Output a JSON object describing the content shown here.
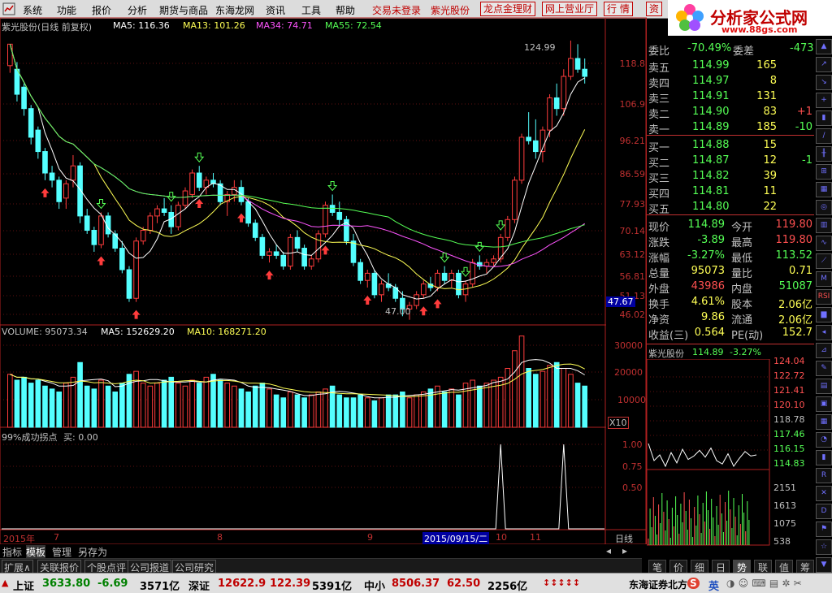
{
  "menubar": {
    "items": [
      "系统",
      "功能",
      "报价",
      "分析",
      "期货与商品",
      "东海龙网",
      "资讯",
      "工具",
      "帮助"
    ],
    "trade_login": "交易未登录",
    "stock_name": "紫光股份",
    "buttons": [
      "龙点金理财",
      "网上营业厅",
      "行 情",
      "资"
    ]
  },
  "logo": {
    "main": "分析家公式网",
    "sub": "www.88gs.com"
  },
  "chart_legend": {
    "title": "紫光股份(日线 前复权)",
    "ma5": "MA5: 116.36",
    "ma13": "MA13: 101.26",
    "ma34": "MA34: 74.71",
    "ma55": "MA55: 72.54"
  },
  "price_scale": [
    "118.8",
    "106.9",
    "96.21",
    "86.59",
    "77.93",
    "70.14",
    "63.12",
    "56.81",
    "51.13",
    "46.02"
  ],
  "annotations": {
    "high": "124.99",
    "low": "47.00",
    "cursor_price": "47.67"
  },
  "volume_legend": {
    "volume": "VOLUME: 95073.34",
    "ma5": "MA5: 152629.20",
    "ma10": "MA10: 168271.20"
  },
  "volume_scale": [
    "30000",
    "20000",
    "10000"
  ],
  "volume_unit": "X10",
  "indicator_legend": {
    "name": "99%成功拐点",
    "buy": "买: 0.00"
  },
  "indicator_scale": [
    "1.00",
    "0.75",
    "0.50"
  ],
  "x_axis": {
    "year": "2015年",
    "months": [
      "7",
      "8",
      "9",
      "10",
      "11"
    ],
    "cursor_date": "2015/09/15/二",
    "period": "日线"
  },
  "bottom_tabs": [
    "指标",
    "模板",
    "管理",
    "另存为"
  ],
  "sub_tabs": [
    "扩展∧",
    "关联报价",
    "个股点评",
    "公司报道",
    "公司研究"
  ],
  "orderbook": {
    "header": {
      "weibi_label": "委比",
      "weibi": "-70.49%",
      "weicha_label": "委差",
      "weicha": "-473"
    },
    "asks": [
      {
        "label": "卖五",
        "price": "114.99",
        "vol": "165",
        "chg": ""
      },
      {
        "label": "卖四",
        "price": "114.97",
        "vol": "8",
        "chg": ""
      },
      {
        "label": "卖三",
        "price": "114.91",
        "vol": "131",
        "chg": ""
      },
      {
        "label": "卖二",
        "price": "114.90",
        "vol": "83",
        "chg": "+1"
      },
      {
        "label": "卖一",
        "price": "114.89",
        "vol": "185",
        "chg": "-10"
      }
    ],
    "bids": [
      {
        "label": "买一",
        "price": "114.88",
        "vol": "15",
        "chg": ""
      },
      {
        "label": "买二",
        "price": "114.87",
        "vol": "12",
        "chg": "-1"
      },
      {
        "label": "买三",
        "price": "114.82",
        "vol": "39",
        "chg": ""
      },
      {
        "label": "买四",
        "price": "114.81",
        "vol": "11",
        "chg": ""
      },
      {
        "label": "买五",
        "price": "114.80",
        "vol": "22",
        "chg": ""
      }
    ]
  },
  "quote": [
    {
      "l1": "现价",
      "v1": "114.89",
      "l2": "今开",
      "v2": "119.80"
    },
    {
      "l1": "涨跌",
      "v1": "-3.89",
      "l2": "最高",
      "v2": "119.80"
    },
    {
      "l1": "涨幅",
      "v1": "-3.27%",
      "l2": "最低",
      "v2": "113.52"
    },
    {
      "l1": "总量",
      "v1": "95073",
      "l2": "量比",
      "v2": "0.71"
    },
    {
      "l1": "外盘",
      "v1": "43986",
      "l2": "内盘",
      "v2": "51087"
    },
    {
      "l1": "换手",
      "v1": "4.61%",
      "l2": "股本",
      "v2": "2.06亿"
    },
    {
      "l1": "净资",
      "v1": "9.86",
      "l2": "流通",
      "v2": "2.06亿"
    },
    {
      "l1": "收益(三)",
      "v1": "0.564",
      "l2": "PE(动)",
      "v2": "152.7"
    }
  ],
  "mini_chart": {
    "name": "紫光股份",
    "price": "114.89",
    "change": "-3.27%",
    "price_scale": [
      "124.04",
      "122.72",
      "121.41",
      "120.10",
      "118.78",
      "117.46",
      "116.15",
      "114.83"
    ],
    "vol_scale": [
      "2151",
      "1613",
      "1075",
      "538"
    ],
    "tabs": [
      "笔",
      "价",
      "细",
      "日",
      "势",
      "联",
      "值",
      "筹"
    ]
  },
  "statusbar": {
    "sh_label": "上证",
    "sh_index": "3633.80",
    "sh_chg": "-6.69",
    "sh_amt": "3571亿",
    "sz_label": "深证",
    "sz_index": "12622.9",
    "sz_chg": "122.39",
    "sz_amt": "5391亿",
    "zx_label": "中小",
    "zx_index": "8506.37",
    "zx_chg": "62.50",
    "zx_amt": "2256亿",
    "broker": "东海证券北方",
    "ime": "英"
  },
  "toolbar_icons": [
    "RSI",
    "VOL",
    "MACD",
    "KDJ"
  ],
  "colors": {
    "up": "#ff3c3c",
    "down": "#54ffff",
    "ma5": "#ffffff",
    "ma13": "#ffff55",
    "ma34": "#ff55ff",
    "ma55": "#55ff55",
    "label_red": "#ff5050",
    "label_green": "#55ff55"
  },
  "chart_data": {
    "type": "candlestick",
    "price_range": [
      46.02,
      124.99
    ],
    "candles": [
      [
        118,
        124,
        116,
        124
      ],
      [
        117,
        119,
        108,
        110
      ],
      [
        112,
        113,
        104,
        106
      ],
      [
        106,
        107,
        96,
        98
      ],
      [
        100,
        101,
        92,
        94
      ],
      [
        94,
        95,
        86,
        88
      ],
      [
        88,
        90,
        84,
        86
      ],
      [
        86,
        87,
        78,
        80
      ],
      [
        81,
        86,
        78,
        85
      ],
      [
        86,
        93,
        84,
        90
      ],
      [
        90,
        91,
        74,
        76
      ],
      [
        76,
        78,
        71,
        72
      ],
      [
        72,
        73,
        66,
        68
      ],
      [
        68,
        77,
        67,
        76
      ],
      [
        76,
        77,
        70,
        71
      ],
      [
        71,
        72,
        66,
        67
      ],
      [
        67,
        69,
        60,
        61
      ],
      [
        61,
        62,
        52,
        53
      ],
      [
        53,
        70,
        52,
        69
      ],
      [
        69,
        73,
        68,
        72
      ],
      [
        72,
        77,
        71,
        76
      ],
      [
        76,
        79,
        74,
        78
      ],
      [
        78,
        81,
        76,
        77
      ],
      [
        77,
        79,
        71,
        73
      ],
      [
        73,
        80,
        72,
        79
      ],
      [
        79,
        84,
        78,
        83
      ],
      [
        82,
        89,
        81,
        88
      ],
      [
        88,
        90,
        83,
        84
      ],
      [
        84,
        87,
        82,
        86
      ],
      [
        86,
        88,
        84,
        85
      ],
      [
        85,
        86,
        79,
        80
      ],
      [
        80,
        83,
        76,
        82
      ],
      [
        82,
        86,
        80,
        84
      ],
      [
        84,
        86,
        79,
        80
      ],
      [
        80,
        81,
        73,
        74
      ],
      [
        74,
        75,
        69,
        70
      ],
      [
        70,
        71,
        64,
        65
      ],
      [
        65,
        67,
        63,
        66
      ],
      [
        66,
        68,
        64,
        65
      ],
      [
        65,
        66,
        61,
        62
      ],
      [
        62,
        71,
        61,
        70
      ],
      [
        70,
        72,
        66,
        67
      ],
      [
        67,
        68,
        61,
        62
      ],
      [
        62,
        65,
        61,
        64
      ],
      [
        64,
        72,
        63,
        71
      ],
      [
        71,
        80,
        70,
        79
      ],
      [
        79,
        82,
        76,
        77
      ],
      [
        77,
        80,
        73,
        75
      ],
      [
        75,
        76,
        68,
        69
      ],
      [
        69,
        71,
        62,
        63
      ],
      [
        63,
        64,
        57,
        58
      ],
      [
        58,
        61,
        56,
        60
      ],
      [
        60,
        61,
        53,
        54
      ],
      [
        54,
        58,
        52,
        57
      ],
      [
        57,
        60,
        55,
        56
      ],
      [
        56,
        57,
        52,
        53
      ],
      [
        53,
        55,
        48,
        50
      ],
      [
        50,
        52,
        47,
        51
      ],
      [
        51,
        55,
        50,
        54
      ],
      [
        54,
        58,
        53,
        57
      ],
      [
        57,
        59,
        55,
        56
      ],
      [
        56,
        61,
        55,
        60
      ],
      [
        60,
        62,
        57,
        58
      ],
      [
        58,
        61,
        56,
        60
      ],
      [
        60,
        61,
        53,
        54
      ],
      [
        54,
        58,
        52,
        57
      ],
      [
        57,
        64,
        56,
        63
      ],
      [
        63,
        65,
        61,
        62
      ],
      [
        62,
        64,
        60,
        63
      ],
      [
        63,
        65,
        62,
        64
      ],
      [
        64,
        71,
        63,
        70
      ],
      [
        70,
        76,
        69,
        75
      ],
      [
        75,
        87,
        74,
        86
      ],
      [
        86,
        99,
        85,
        98
      ],
      [
        98,
        105,
        96,
        97
      ],
      [
        97,
        103,
        92,
        94
      ],
      [
        94,
        101,
        91,
        100
      ],
      [
        100,
        110,
        98,
        109
      ],
      [
        109,
        113,
        104,
        106
      ],
      [
        106,
        117,
        104,
        115
      ],
      [
        115,
        125,
        114,
        120
      ],
      [
        120,
        124,
        116,
        117
      ],
      [
        117,
        120,
        113,
        115
      ]
    ],
    "volume": [
      180,
      160,
      170,
      150,
      160,
      140,
      130,
      120,
      150,
      170,
      220,
      140,
      130,
      160,
      140,
      120,
      150,
      180,
      190,
      150,
      140,
      150,
      160,
      170,
      150,
      140,
      160,
      150,
      170,
      180,
      160,
      150,
      140,
      130,
      120,
      140,
      150,
      130,
      110,
      100,
      120,
      110,
      100,
      110,
      120,
      130,
      140,
      110,
      100,
      100,
      110,
      100,
      90,
      100,
      110,
      110,
      120,
      100,
      110,
      120,
      130,
      140,
      120,
      130,
      110,
      150,
      160,
      140,
      150,
      160,
      170,
      200,
      260,
      310,
      200,
      180,
      190,
      210,
      220,
      200,
      180,
      150,
      140
    ],
    "turning_points": [
      {
        "index": 70,
        "value": 1.0
      },
      {
        "index": 79,
        "value": 1.0
      }
    ]
  }
}
